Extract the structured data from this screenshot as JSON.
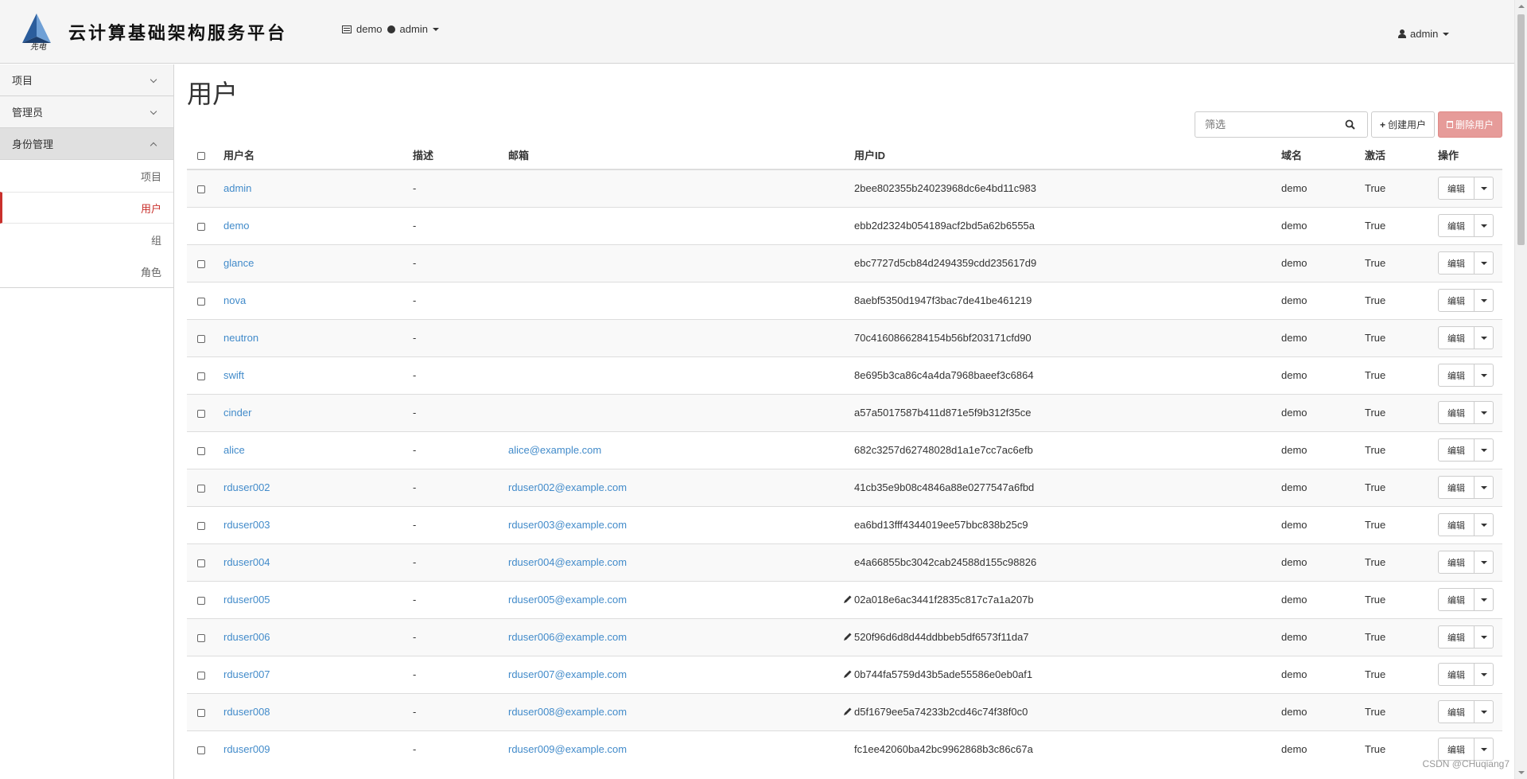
{
  "header": {
    "brand_title": "云计算基础架构服务平台",
    "logo_glyph": "先电",
    "project_label": "demo",
    "region_label": "admin",
    "user_label": "admin"
  },
  "sidebar": {
    "groups": [
      {
        "label": "项目"
      },
      {
        "label": "管理员"
      },
      {
        "label": "身份管理"
      }
    ],
    "sub_items": [
      {
        "label": "项目"
      },
      {
        "label": "用户"
      },
      {
        "label": "组"
      },
      {
        "label": "角色"
      }
    ]
  },
  "main": {
    "title": "用户",
    "filter_placeholder": "筛选",
    "create_label": "创建用户",
    "delete_label": "删除用户"
  },
  "table": {
    "headers": {
      "name": "用户名",
      "desc": "描述",
      "email": "邮箱",
      "id": "用户ID",
      "domain": "域名",
      "enabled": "激活",
      "actions": "操作"
    },
    "edit_label": "编辑",
    "rows": [
      {
        "name": "admin",
        "desc": "-",
        "email": "",
        "id": "2bee802355b24023968dc6e4bd11c983",
        "domain": "demo",
        "enabled": "True"
      },
      {
        "name": "demo",
        "desc": "-",
        "email": "",
        "id": "ebb2d2324b054189acf2bd5a62b6555a",
        "domain": "demo",
        "enabled": "True"
      },
      {
        "name": "glance",
        "desc": "-",
        "email": "",
        "id": "ebc7727d5cb84d2494359cdd235617d9",
        "domain": "demo",
        "enabled": "True"
      },
      {
        "name": "nova",
        "desc": "-",
        "email": "",
        "id": "8aebf5350d1947f3bac7de41be461219",
        "domain": "demo",
        "enabled": "True"
      },
      {
        "name": "neutron",
        "desc": "-",
        "email": "",
        "id": "70c4160866284154b56bf203171cfd90",
        "domain": "demo",
        "enabled": "True"
      },
      {
        "name": "swift",
        "desc": "-",
        "email": "",
        "id": "8e695b3ca86c4a4da7968baeef3c6864",
        "domain": "demo",
        "enabled": "True"
      },
      {
        "name": "cinder",
        "desc": "-",
        "email": "",
        "id": "a57a5017587b411d871e5f9b312f35ce",
        "domain": "demo",
        "enabled": "True"
      },
      {
        "name": "alice",
        "desc": "-",
        "email": "alice@example.com",
        "id": "682c3257d62748028d1a1e7cc7ac6efb",
        "domain": "demo",
        "enabled": "True"
      },
      {
        "name": "rduser002",
        "desc": "-",
        "email": "rduser002@example.com",
        "id": "41cb35e9b08c4846a88e0277547a6fbd",
        "domain": "demo",
        "enabled": "True"
      },
      {
        "name": "rduser003",
        "desc": "-",
        "email": "rduser003@example.com",
        "id": "ea6bd13fff4344019ee57bbc838b25c9",
        "domain": "demo",
        "enabled": "True"
      },
      {
        "name": "rduser004",
        "desc": "-",
        "email": "rduser004@example.com",
        "id": "e4a66855bc3042cab24588d155c98826",
        "domain": "demo",
        "enabled": "True"
      },
      {
        "name": "rduser005",
        "desc": "-",
        "email": "rduser005@example.com",
        "id": "02a018e6ac3441f2835c817c7a1a207b",
        "domain": "demo",
        "enabled": "True",
        "pencil": true
      },
      {
        "name": "rduser006",
        "desc": "-",
        "email": "rduser006@example.com",
        "id": "520f96d6d8d44ddbbeb5df6573f11da7",
        "domain": "demo",
        "enabled": "True",
        "pencil": true
      },
      {
        "name": "rduser007",
        "desc": "-",
        "email": "rduser007@example.com",
        "id": "0b744fa5759d43b5ade55586e0eb0af1",
        "domain": "demo",
        "enabled": "True",
        "pencil": true
      },
      {
        "name": "rduser008",
        "desc": "-",
        "email": "rduser008@example.com",
        "id": "d5f1679ee5a74233b2cd46c74f38f0c0",
        "domain": "demo",
        "enabled": "True",
        "pencil": true
      },
      {
        "name": "rduser009",
        "desc": "-",
        "email": "rduser009@example.com",
        "id": "fc1ee42060ba42bc9962868b3c86c67a",
        "domain": "demo",
        "enabled": "True"
      }
    ]
  },
  "watermark": "CSDN @CHuqiang7",
  "colors": {
    "link": "#428bca",
    "active": "#c9302c",
    "danger_button": "#e69b99"
  }
}
